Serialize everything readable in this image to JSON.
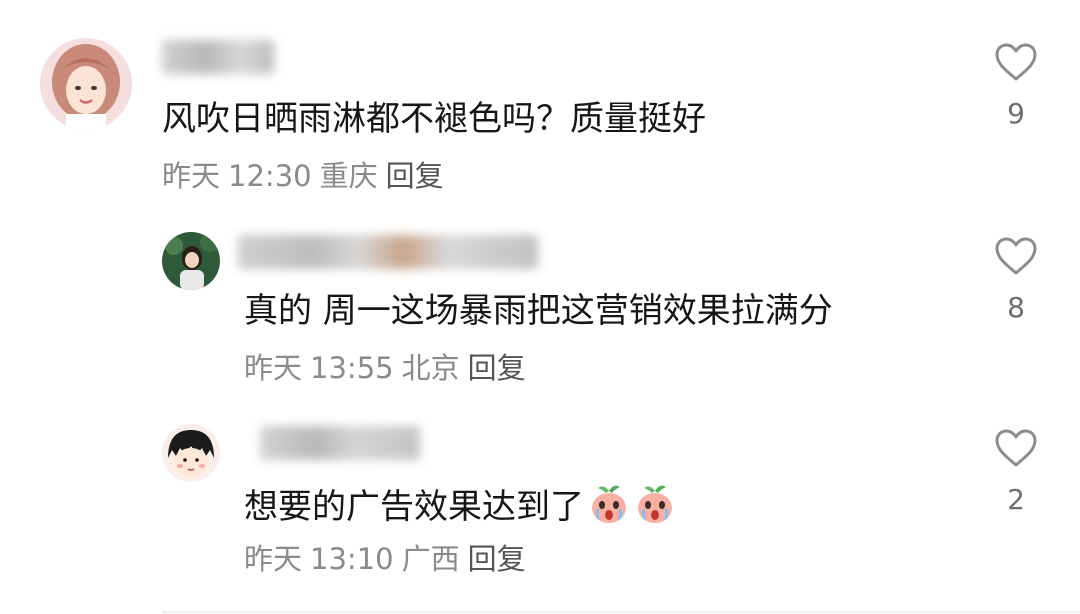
{
  "comments": [
    {
      "text": "风吹日晒雨淋都不褪色吗？质量挺好",
      "date": "昨天",
      "time": "12:30",
      "location": "重庆",
      "reply_label": "回复",
      "likes": "9",
      "username_blurred": true,
      "avatar": "avatar-woman-photo"
    },
    {
      "text": "真的 周一这场暴雨把这营销效果拉满分",
      "date": "昨天",
      "time": "13:55",
      "location": "北京",
      "reply_label": "回复",
      "likes": "8",
      "username_blurred": true,
      "avatar": "avatar-girl-photo"
    },
    {
      "text": "想要的广告效果达到了",
      "date": "昨天",
      "time": "13:10",
      "location": "广西",
      "reply_label": "回复",
      "likes": "2",
      "username_blurred": true,
      "avatar": "avatar-cartoon-girl",
      "emojis": [
        "crying-peach-emoji",
        "crying-peach-emoji"
      ]
    }
  ],
  "colors": {
    "text": "#161616",
    "meta": "#8a8a8a",
    "like_icon": "#8c8c8c",
    "background": "#ffffff"
  }
}
